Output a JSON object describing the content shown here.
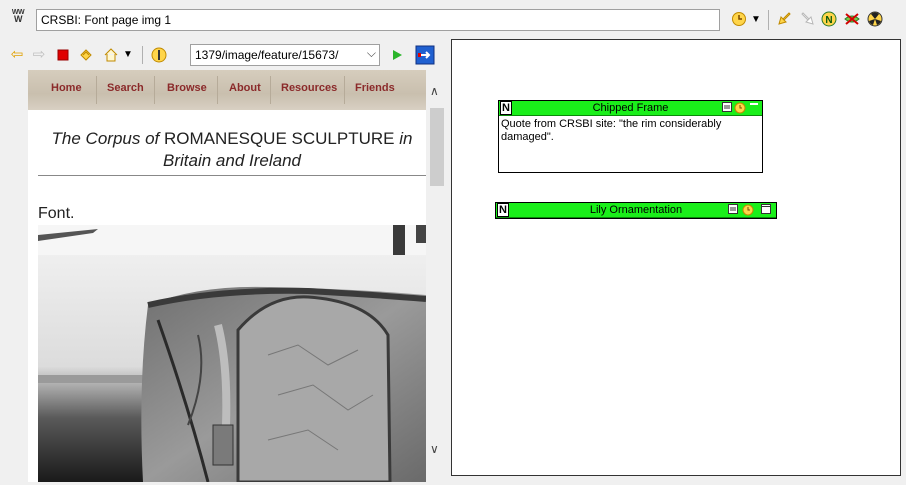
{
  "window": {
    "app_icon_text": "WW",
    "title": "CRSBI: Font page img 1"
  },
  "toolbar": {
    "icons": [
      "clock-dropdown-icon",
      "back-link-icon",
      "forward-link-icon",
      "n-note-icon",
      "no-link-icon",
      "radiation-icon"
    ]
  },
  "navigation": {
    "url": "1379/image/feature/15673/",
    "icons": [
      "back-arrow-icon",
      "forward-arrow-icon",
      "stop-icon",
      "refresh-icon",
      "home-icon",
      "info-icon",
      "go-icon",
      "bookmark-icon"
    ]
  },
  "site": {
    "nav_items": [
      "Home",
      "Search",
      "Browse",
      "About",
      "Resources",
      "Friends"
    ],
    "heading_part1": "The Corpus of",
    "heading_part2": "ROMANESQUE SCULPTURE",
    "heading_part3": "in",
    "heading_line2": "Britain and Ireland",
    "feature_label": "Font."
  },
  "notes": [
    {
      "title": "Chipped Frame",
      "body": "Quote from CRSBI site: \"the rim considerably damaged\"."
    },
    {
      "title": "Lily Ornamentation",
      "body": ""
    }
  ],
  "colors": {
    "note_header": "#1aef1a",
    "site_nav_text": "#8b2a2a"
  }
}
